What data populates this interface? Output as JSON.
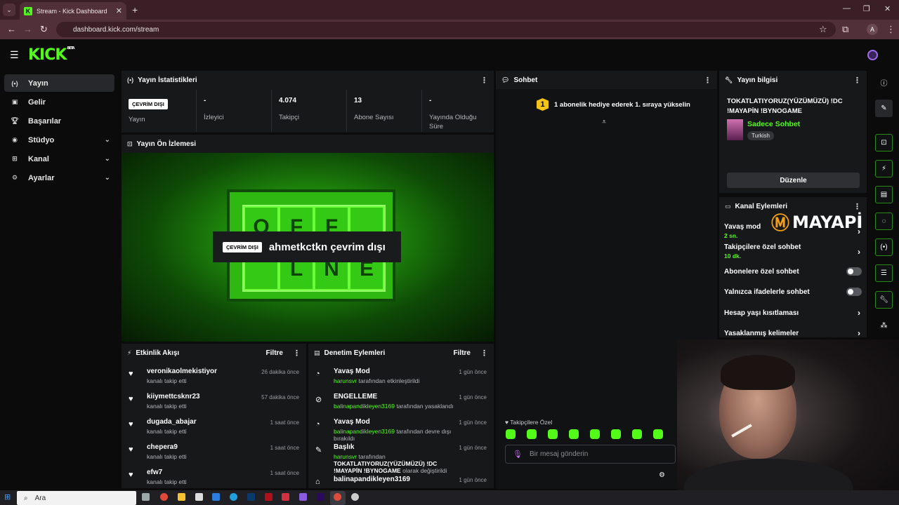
{
  "browser": {
    "tab_title": "Stream - Kick Dashboard",
    "tab_favicon": "K",
    "url": "dashboard.kick.com/stream",
    "profile_initial": "A"
  },
  "header": {
    "logo": "KICK",
    "logo_tag": "BETA"
  },
  "sidebar": {
    "items": [
      {
        "label": "Yayın",
        "icon": "broadcast-icon",
        "active": true
      },
      {
        "label": "Gelir",
        "icon": "revenue-icon"
      },
      {
        "label": "Başarılar",
        "icon": "trophy-icon"
      },
      {
        "label": "Stüdyo",
        "icon": "studio-icon",
        "expandable": true
      },
      {
        "label": "Kanal",
        "icon": "channel-icon",
        "expandable": true
      },
      {
        "label": "Ayarlar",
        "icon": "gear-icon",
        "expandable": true
      }
    ]
  },
  "stats": {
    "title": "Yayın İstatistikleri",
    "items": [
      {
        "value": "ÇEVRİM DIŞI",
        "label": "Yayın"
      },
      {
        "value": "-",
        "label": "İzleyici"
      },
      {
        "value": "4.074",
        "label": "Takipçi"
      },
      {
        "value": "13",
        "label": "Abone Sayısı"
      },
      {
        "value": "-",
        "label": "Yayında Olduğu Süre"
      }
    ]
  },
  "preview": {
    "title": "Yayın Ön İzlemesi",
    "sign_letters": [
      "O",
      "F",
      "F",
      "",
      "",
      "L",
      "N",
      "E"
    ],
    "badge": "ÇEVRİM DIŞI",
    "message": "ahmetkctkn çevrim dışı"
  },
  "activity": {
    "title": "Etkinlik Akışı",
    "filter": "Filtre",
    "items": [
      {
        "name": "veronikaolmekistiyor",
        "sub": "kanalı takip etti",
        "time": "26 dakika önce"
      },
      {
        "name": "kiiymettcsknr23",
        "sub": "kanalı takip etti",
        "time": "57 dakika önce"
      },
      {
        "name": "dugada_abajar",
        "sub": "kanalı takip etti",
        "time": "1 saat önce"
      },
      {
        "name": "chepera9",
        "sub": "kanalı takip etti",
        "time": "1 saat önce"
      },
      {
        "name": "efw7",
        "sub": "kanalı takip etti",
        "time": "1 saat önce"
      }
    ]
  },
  "moderation": {
    "title": "Denetim Eylemleri",
    "filter": "Filtre",
    "items": [
      {
        "name": "Yavaş Mod",
        "user": "harunsvr",
        "text": "tarafından etkinleştirildi",
        "time": "1 gün önce"
      },
      {
        "name": "ENGELLEME",
        "user": "balinapandikleyen3169",
        "text": "tarafından yasaklandı",
        "time": "1 gün önce"
      },
      {
        "name": "Yavaş Mod",
        "user": "balinapandikleyen3169",
        "text": "tarafından devre dışı bırakıldı",
        "time": "1 gün önce"
      },
      {
        "name": "Başlık",
        "user": "harunsvr",
        "text": "tarafından",
        "bold": "TOKATLATIYORUZ(YÜZÜMÜZÜ) !DC !MAYAPİN !BYNOGAME",
        "text2": "olarak değiştirildi",
        "time": "1 gün önce"
      },
      {
        "name": "balinapandikleyen3169",
        "time": "1 gün önce"
      }
    ]
  },
  "chat": {
    "title": "Sohbet",
    "pinned": "1 abonelik hediye ederek 1. sıraya yükselin",
    "pinned_rank": "1",
    "followers_only": "Takipçilere Özel",
    "placeholder": "Bir mesaj gönderin"
  },
  "info": {
    "title": "Yayın bilgisi",
    "stream_title": "TOKATLATIYORUZ(YÜZÜMÜZÜ) !DC !MAYAPİN !BYNOGAME",
    "category": "Sadece Sohbet",
    "language": "Turkish",
    "edit": "Düzenle"
  },
  "channel_actions": {
    "title": "Kanal Eylemleri",
    "items": [
      {
        "label": "Yavaş mod",
        "sub": "2 sn.",
        "type": "arrow"
      },
      {
        "label": "Takipçilere özel sohbet",
        "sub": "10 dk.",
        "type": "arrow"
      },
      {
        "label": "Abonelere özel sohbet",
        "type": "toggle"
      },
      {
        "label": "Yalnızca ifadelerle sohbet",
        "type": "toggle"
      },
      {
        "label": "Hesap yaşı kısıtlaması",
        "type": "arrow"
      },
      {
        "label": "Yasaklanmış kelimeler",
        "type": "arrow"
      }
    ]
  },
  "overlay": {
    "brand": "MAYAPİ"
  },
  "taskbar": {
    "search": "Ara"
  },
  "colors": {
    "accent": "#53fc18",
    "bg": "#0b0b0c",
    "panel": "#17181a"
  }
}
